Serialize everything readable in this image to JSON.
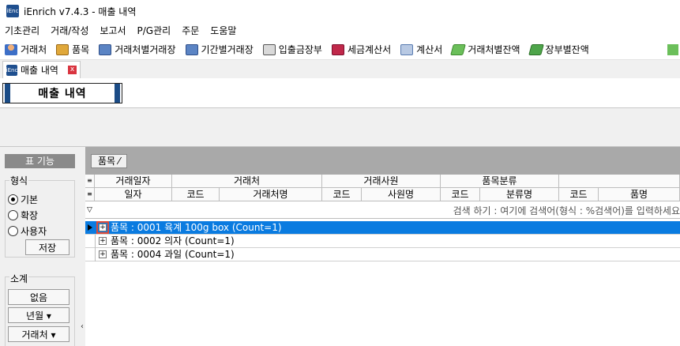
{
  "window": {
    "title": "iEnrich v7.4.3 - 매출 내역",
    "app_icon_text": "iEnc"
  },
  "menubar": [
    {
      "label": "기초관리"
    },
    {
      "label": "거래/작성"
    },
    {
      "label": "보고서"
    },
    {
      "label": "P/G관리"
    },
    {
      "label": "주문"
    },
    {
      "label": "도움말"
    }
  ],
  "toolbar": [
    {
      "label": "거래처",
      "icon": "person-icon"
    },
    {
      "label": "품목",
      "icon": "box-icon"
    },
    {
      "label": "거래처별거래장",
      "icon": "ledger-icon"
    },
    {
      "label": "기간별거래장",
      "icon": "ledger-icon"
    },
    {
      "label": "입출금장부",
      "icon": "calculator-icon"
    },
    {
      "label": "세금계산서",
      "icon": "tax-invoice-icon"
    },
    {
      "label": "계산서",
      "icon": "invoice-icon"
    },
    {
      "label": "거래처별잔액",
      "icon": "money-icon"
    },
    {
      "label": "장부별잔액",
      "icon": "money-icon"
    }
  ],
  "doc_tab": {
    "label": "매출 내역",
    "close": "x"
  },
  "page_title": "매출 내역",
  "left_panel": {
    "title": "표 기능",
    "format_label": "형식",
    "format_options": [
      {
        "label": "기본",
        "selected": true
      },
      {
        "label": "확장",
        "selected": false
      },
      {
        "label": "사용자",
        "selected": false
      }
    ],
    "save_button": "저장",
    "subtotal_label": "소계",
    "subtotal_buttons": [
      "없음",
      "년월 ▾",
      "거래처 ▾"
    ],
    "collapse": "‹"
  },
  "grid": {
    "group_chip": "품목 ⁄",
    "header_top": [
      "거래일자",
      "거래처",
      "거래사원",
      "품목분류",
      ""
    ],
    "header_bottom": [
      "일자",
      "코드",
      "거래처명",
      "코드",
      "사원명",
      "코드",
      "분류명",
      "코드",
      "품명"
    ],
    "search_hint": "검색 하기 : 여기에 검색어(형식 : %검색어)를 입력하세요",
    "groups": [
      {
        "text": "품목 : 0001 육계 100g box (Count=1)",
        "selected": true
      },
      {
        "text": "품목 : 0002 의자   (Count=1)",
        "selected": false
      },
      {
        "text": "품목 : 0004 과일   (Count=1)",
        "selected": false
      }
    ]
  }
}
